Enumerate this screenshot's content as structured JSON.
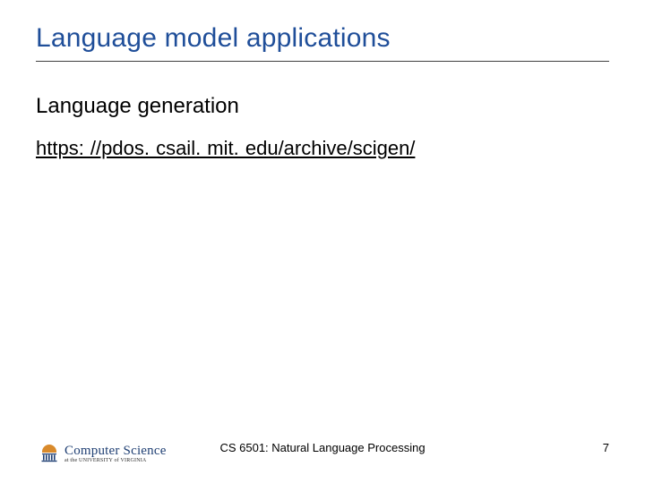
{
  "title": "Language model applications",
  "subtitle": "Language generation",
  "link_text": "https: //pdos. csail. mit. edu/archive/scigen/",
  "footer": {
    "logo_main": "Computer Science",
    "logo_sub": "at the UNIVERSITY of VIRGINIA",
    "course": "CS 6501: Natural Language Processing",
    "page": "7"
  }
}
